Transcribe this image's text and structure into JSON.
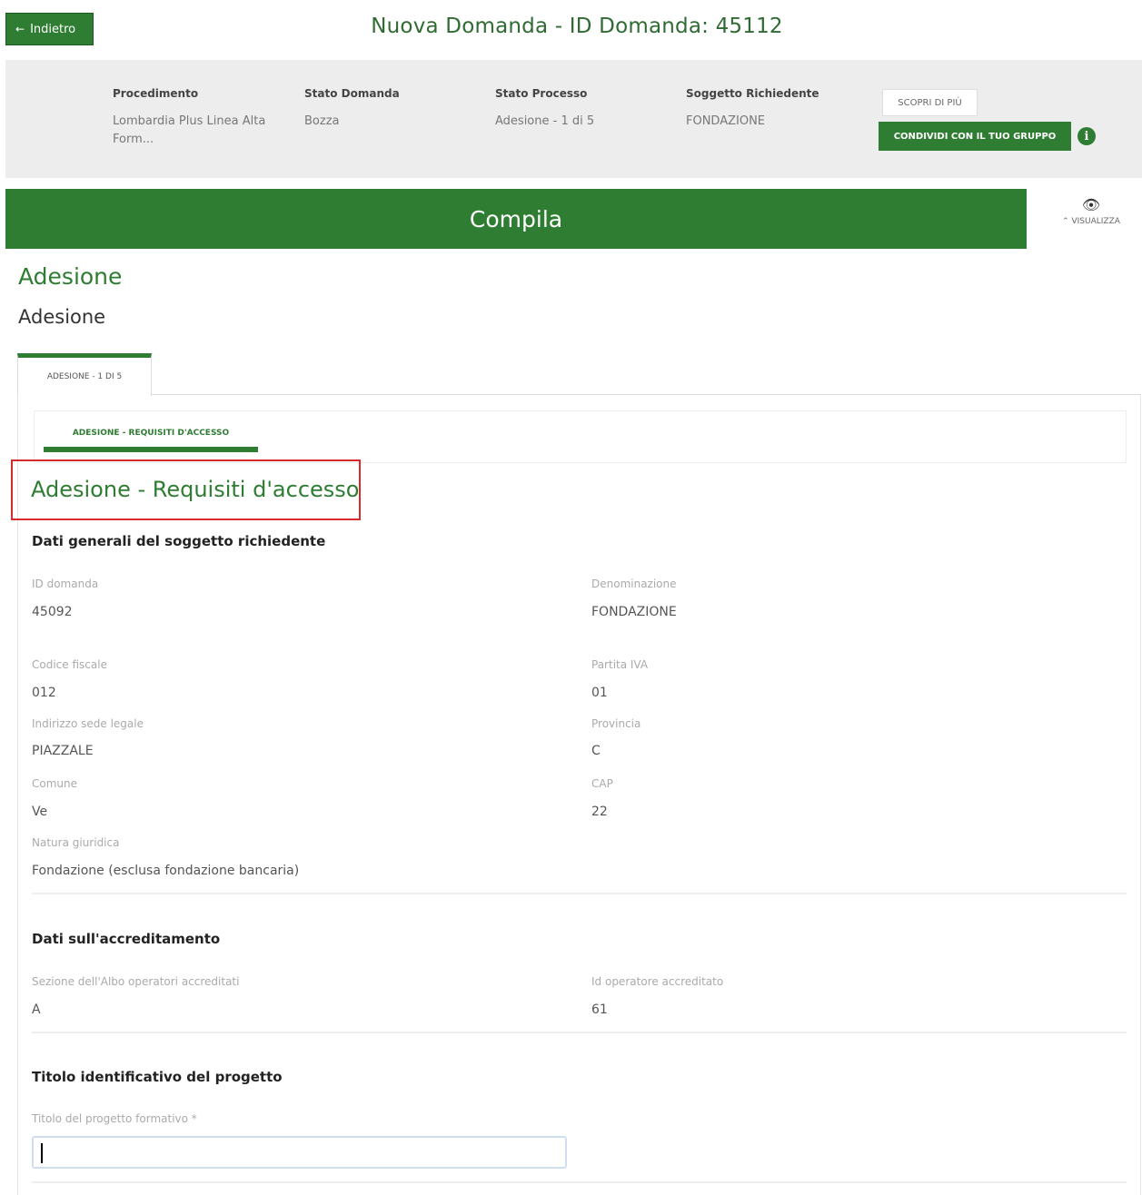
{
  "header": {
    "back_arrow": "←",
    "back_label": "Indietro",
    "title": "Nuova Domanda - ID Domanda: 45112"
  },
  "info": {
    "procedimento_label": "Procedimento",
    "procedimento_value": "Lombardia Plus Linea Alta Form...",
    "stato_domanda_label": "Stato Domanda",
    "stato_domanda_value": "Bozza",
    "stato_processo_label": "Stato Processo",
    "stato_processo_value": "Adesione - 1 di 5",
    "soggetto_label": "Soggetto Richiedente",
    "soggetto_value": "FONDAZIONE",
    "scopri_label": "SCOPRI DI PIÙ",
    "condividi_label": "CONDIVIDI CON IL TUO GRUPPO",
    "info_icon": "i"
  },
  "compila": {
    "label": "Compila",
    "visualizza_label": "VISUALIZZA",
    "visualizza_chevron": "⌃",
    "eye_icon": "👁"
  },
  "section": {
    "title": "Adesione",
    "subtitle": "Adesione",
    "tab_label": "ADESIONE - 1 DI 5",
    "subtab_label": "ADESIONE - REQUISITI D'ACCESSO",
    "form_title": "Adesione - Requisiti d'accesso"
  },
  "dati_generali": {
    "title": "Dati generali del soggetto richiedente",
    "id_domanda_label": "ID domanda",
    "id_domanda_value": "45092",
    "denominazione_label": "Denominazione",
    "denominazione_value": "FONDAZIONE",
    "codice_fiscale_label": "Codice fiscale",
    "codice_fiscale_value": "012",
    "partita_iva_label": "Partita IVA",
    "partita_iva_value": "01",
    "indirizzo_label": "Indirizzo sede legale",
    "indirizzo_value": "PIAZZALE",
    "provincia_label": "Provincia",
    "provincia_value": "C",
    "comune_label": "Comune",
    "comune_value": "Ve",
    "cap_label": "CAP",
    "cap_value": "22",
    "natura_label": "Natura giuridica",
    "natura_value": "Fondazione (esclusa fondazione bancaria)"
  },
  "accreditamento": {
    "title": "Dati sull'accreditamento",
    "sezione_label": "Sezione dell'Albo operatori accreditati",
    "sezione_value": "A",
    "id_operatore_label": "Id operatore accreditato",
    "id_operatore_value": "61"
  },
  "titolo": {
    "title": "Titolo identificativo del progetto",
    "input_label": "Titolo del progetto formativo *",
    "input_value": ""
  },
  "colors": {
    "primary_green": "#2e7d32",
    "highlight_red": "#d52b2b",
    "info_bg": "#ededed"
  }
}
